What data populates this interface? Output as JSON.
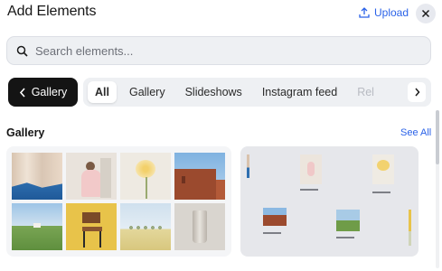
{
  "header": {
    "title": "Add Elements",
    "upload_label": "Upload"
  },
  "search": {
    "placeholder": "Search elements..."
  },
  "nav": {
    "back_label": "Gallery",
    "chips": [
      {
        "label": "All",
        "active": true
      },
      {
        "label": "Gallery"
      },
      {
        "label": "Slideshows"
      },
      {
        "label": "Instagram feed"
      },
      {
        "label": "Rel"
      }
    ]
  },
  "section": {
    "title": "Gallery",
    "see_all": "See All"
  },
  "colors": {
    "accent": "#2a62e8",
    "dark_button": "#141414",
    "chip_bar": "#eef0f3"
  },
  "icons": [
    "upload-icon",
    "close-icon",
    "search-icon",
    "chevron-left-icon",
    "chevron-right-icon"
  ]
}
